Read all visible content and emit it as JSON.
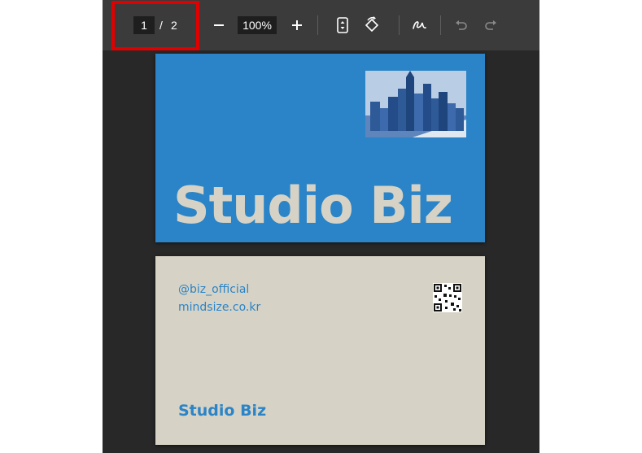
{
  "toolbar": {
    "page_current": "1",
    "page_separator": "/",
    "page_total": "2",
    "zoom_level": "100%",
    "zoom_out_icon": "minus-icon",
    "zoom_in_icon": "plus-icon",
    "fit_page_icon": "fit-page-icon",
    "rotate_icon": "rotate-icon",
    "draw_icon": "draw-icon",
    "undo_icon": "undo-icon",
    "redo_icon": "redo-icon"
  },
  "card_front": {
    "title": "Studio Biz",
    "image": "city-skyline-image"
  },
  "card_back": {
    "handle": "@biz_official",
    "website": "mindsize.co.kr",
    "brand": "Studio Biz",
    "qr": "qr-code"
  },
  "colors": {
    "card_blue": "#2a84c7",
    "card_cream": "#d6d3c6",
    "highlight": "#e00000"
  }
}
